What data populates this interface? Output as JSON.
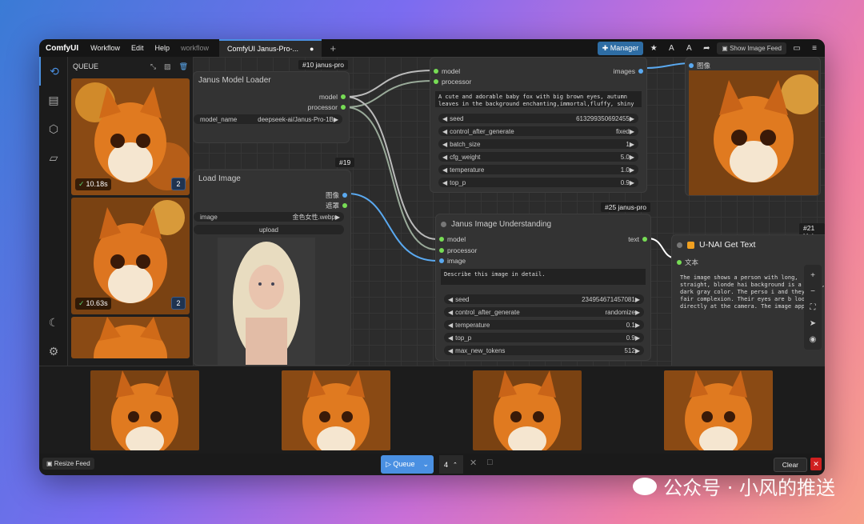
{
  "app": {
    "logo": "ComfyUI",
    "menus": [
      "Workflow",
      "Edit",
      "Help"
    ],
    "workflow_label": "workflow",
    "tab": "ComfyUI Janus-Pro-...",
    "manager": "Manager",
    "feed_toggle": "Show Image Feed"
  },
  "queue": {
    "title": "QUEUE",
    "items": [
      {
        "time": "10.18s",
        "count": "2"
      },
      {
        "time": "10.63s",
        "count": "2"
      }
    ]
  },
  "nodes": {
    "loader": {
      "badge": "#10 janus-pro",
      "title": "Janus Model Loader",
      "out1": "model",
      "out2": "processor",
      "w_name": "model_name",
      "w_val": "deepseek-ai/Janus-Pro-1B"
    },
    "loadimg": {
      "badge": "#19",
      "title": "Load Image",
      "out1": "图像",
      "out2": "遮罩",
      "w_name": "image",
      "w_val": "金色女性.webp",
      "upload": "upload"
    },
    "gen": {
      "in1": "model",
      "in2": "processor",
      "out": "images",
      "prompt": "A cute and adorable baby fox with big brown eyes, autumn leaves in the background enchanting,immortal,fluffy, shiny",
      "widgets": [
        [
          "seed",
          "613299350692455"
        ],
        [
          "control_after_generate",
          "fixed"
        ],
        [
          "batch_size",
          "1"
        ],
        [
          "cfg_weight",
          "5.0"
        ],
        [
          "temperature",
          "1.0"
        ],
        [
          "top_p",
          "0.9"
        ]
      ]
    },
    "preview": {
      "in": "图像"
    },
    "und": {
      "badge": "#25 janus-pro",
      "title": "Janus Image Understanding",
      "in1": "model",
      "in2": "processor",
      "in3": "image",
      "out": "text",
      "prompt": "Describe this image in detail.",
      "widgets": [
        [
          "seed",
          "234954671457081"
        ],
        [
          "control_after_generate",
          "randomize"
        ],
        [
          "temperature",
          "0.1"
        ],
        [
          "top_p",
          "0.9"
        ],
        [
          "max_new_tokens",
          "512"
        ]
      ]
    },
    "gettext": {
      "badge": "#21 Uni",
      "title": "U-NAI Get Text",
      "in": "文本",
      "text": "The image shows a person with long, straight, blonde hai background is a plain, dark gray color. The perso i and they have a fair complexion. Their eyes are b looking directly at the camera. The image appears focusing on the upper part of the face and hair."
    }
  },
  "bottom": {
    "resize": "Resize Feed",
    "queue": "Queue",
    "count": "4",
    "clear": "Clear"
  },
  "watermark": "公众号 · 小风的推送"
}
